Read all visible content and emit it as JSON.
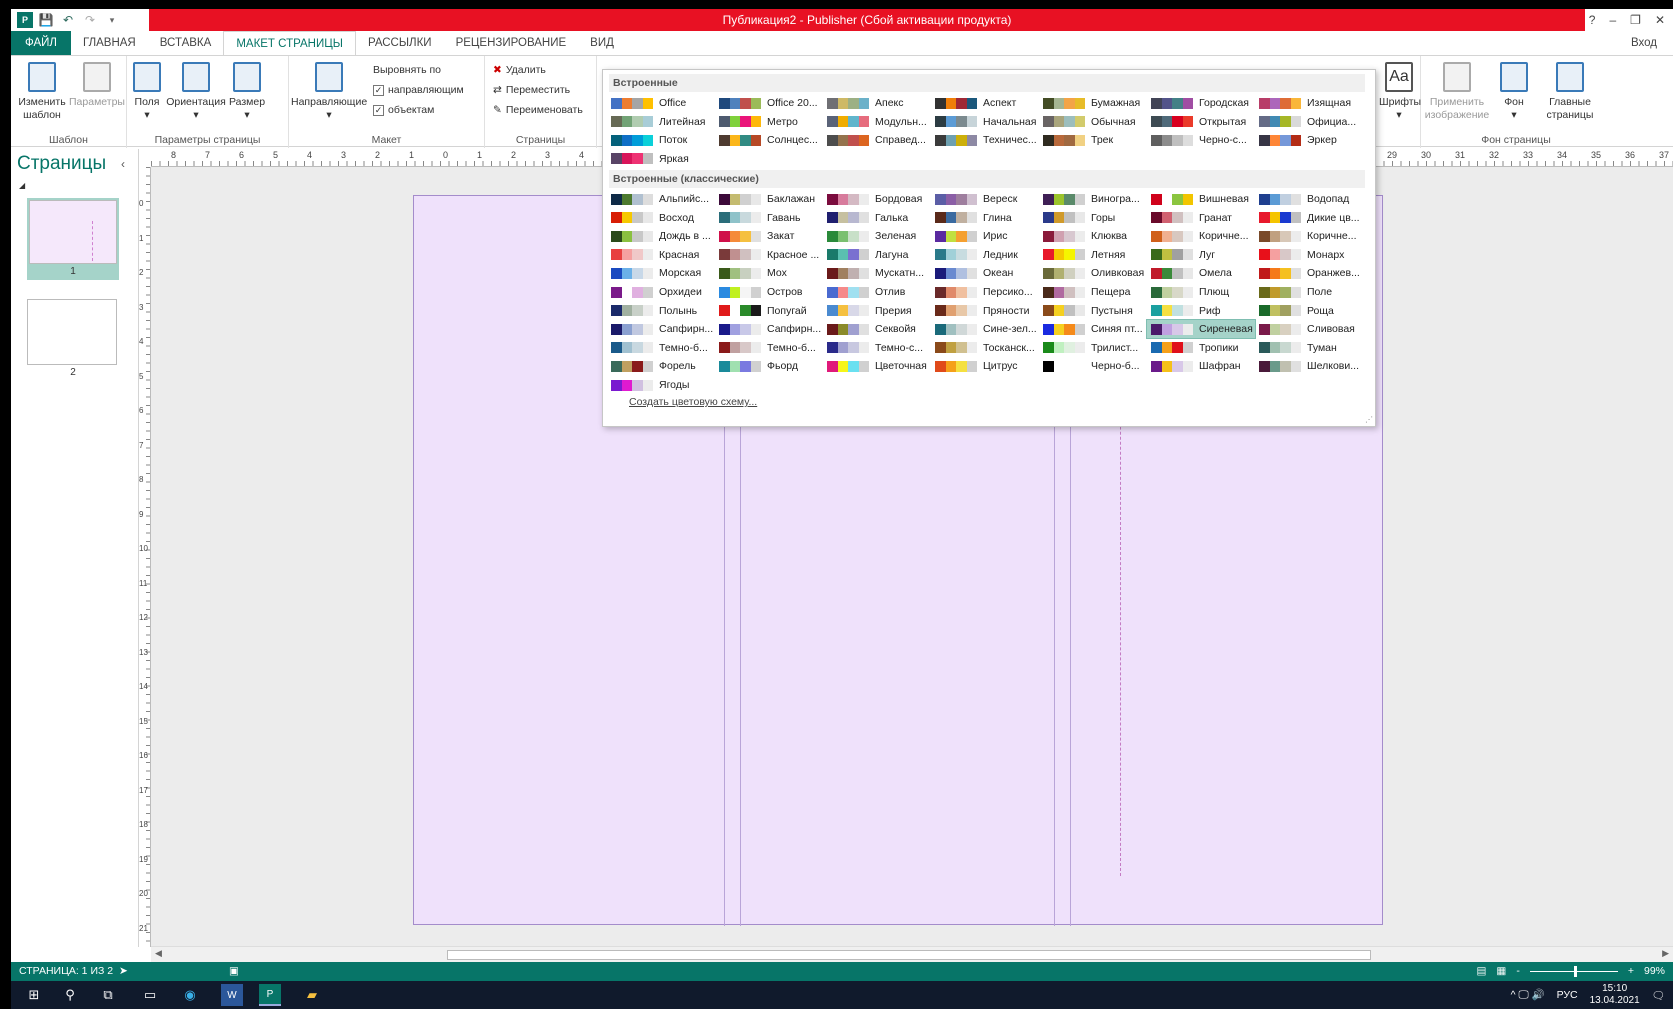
{
  "window": {
    "title": "Публикация2 -  Publisher (Сбой активации продукта)",
    "help": "?",
    "controls": [
      "–",
      "❐",
      "✕"
    ]
  },
  "tabs": [
    "ФАЙЛ",
    "ГЛАВНАЯ",
    "ВСТАВКА",
    "МАКЕТ СТРАНИЦЫ",
    "РАССЫЛКИ",
    "РЕЦЕНЗИРОВАНИЕ",
    "ВИД"
  ],
  "signin": "Вход",
  "ribbon": {
    "template": {
      "label": "Шаблон",
      "change": "Изменить шаблон",
      "params": "Параметры"
    },
    "page_setup": {
      "label": "Параметры страницы",
      "margins": "Поля",
      "orientation": "Ориентация",
      "size": "Размер"
    },
    "layout": {
      "label": "Макет",
      "guides": "Направляющие",
      "align_by": "Выровнять по",
      "to_guides": "направляющим",
      "to_objects": "объектам"
    },
    "pages": {
      "label": "Страницы",
      "delete": "Удалить",
      "move": "Переместить",
      "rename": "Переименовать"
    },
    "fonts": "Шрифты",
    "fonts_icon_text": "Aa",
    "background": {
      "label": "Фон страницы",
      "apply_image": "Применить изображение",
      "bg": "Фон",
      "master": "Главные страницы"
    }
  },
  "ruler_labels": [
    "8",
    "7",
    "6",
    "5",
    "4",
    "3",
    "2",
    "1",
    "0",
    "1",
    "2",
    "3",
    "4"
  ],
  "ruler_labels_right": [
    "29",
    "30",
    "31",
    "32",
    "33",
    "34",
    "35",
    "36",
    "37"
  ],
  "vruler_labels": [
    "0",
    "1",
    "2",
    "3",
    "4",
    "5",
    "6",
    "7",
    "8",
    "9",
    "10",
    "11",
    "12",
    "13",
    "14",
    "15",
    "16",
    "17",
    "18",
    "19",
    "20",
    "21"
  ],
  "pages_panel": {
    "title": "Страницы",
    "pages": [
      "1",
      "2"
    ]
  },
  "dropdown": {
    "builtin_title": "Встроенные",
    "classic_title": "Встроенные (классические)",
    "create_link": "Создать цветовую схему...",
    "builtin": [
      {
        "name": "Office",
        "c": [
          "#4472c4",
          "#ed7d31",
          "#a5a5a5",
          "#ffc000"
        ]
      },
      {
        "name": "Office 20...",
        "c": [
          "#1f497d",
          "#4f81bd",
          "#c0504d",
          "#9bbb59"
        ]
      },
      {
        "name": "Апекс",
        "c": [
          "#6f6f74",
          "#ceb966",
          "#9cb084",
          "#6bb1c9"
        ]
      },
      {
        "name": "Аспект",
        "c": [
          "#323232",
          "#f07f09",
          "#9f2936",
          "#1b587c"
        ]
      },
      {
        "name": "Бумажная",
        "c": [
          "#444d26",
          "#a5b592",
          "#f3a447",
          "#e7bc29"
        ]
      },
      {
        "name": "Городская",
        "c": [
          "#424456",
          "#53548a",
          "#438086",
          "#a04da3"
        ]
      },
      {
        "name": "Изящная",
        "c": [
          "#b83d68",
          "#ac66bb",
          "#de6c36",
          "#f9b639"
        ]
      },
      {
        "name": "Литейная",
        "c": [
          "#676a55",
          "#72a376",
          "#b0ccb0",
          "#a8cdd7"
        ]
      },
      {
        "name": "Метро",
        "c": [
          "#4e5b6f",
          "#7fd13b",
          "#ea157a",
          "#feb80a"
        ]
      },
      {
        "name": "Модульн...",
        "c": [
          "#5a6378",
          "#f0ad00",
          "#60b5cc",
          "#e66c7d"
        ]
      },
      {
        "name": "Начальная",
        "c": [
          "#2c3c43",
          "#5b9bd5",
          "#7b8a8f",
          "#c7d4d9"
        ]
      },
      {
        "name": "Обычная",
        "c": [
          "#696464",
          "#a9a57c",
          "#9cbebd",
          "#d2cb6c"
        ]
      },
      {
        "name": "Открытая",
        "c": [
          "#3d4b53",
          "#4f6a7a",
          "#d8001f",
          "#ea3a2a"
        ]
      },
      {
        "name": "Официа...",
        "c": [
          "#646b86",
          "#418ab3",
          "#a6b727",
          "#d9d9d9"
        ]
      },
      {
        "name": "Поток",
        "c": [
          "#04617b",
          "#0f6fc6",
          "#009dd9",
          "#0bd0d9"
        ]
      },
      {
        "name": "Солнцес...",
        "c": [
          "#4e3b30",
          "#fbb61a",
          "#318b83",
          "#b64926"
        ]
      },
      {
        "name": "Справед...",
        "c": [
          "#4d4d4d",
          "#94734d",
          "#c0504d",
          "#dc6520"
        ]
      },
      {
        "name": "Техничес...",
        "c": [
          "#3b3b3b",
          "#6ea0b0",
          "#ccaf0a",
          "#8d89a4"
        ]
      },
      {
        "name": "Трек",
        "c": [
          "#2f2b20",
          "#b8693b",
          "#a06940",
          "#f1d183"
        ]
      },
      {
        "name": "Черно-с...",
        "c": [
          "#5f5f5f",
          "#8c8c8c",
          "#bfbfbf",
          "#dddddd"
        ]
      },
      {
        "name": "Эркер",
        "c": [
          "#373545",
          "#fe8637",
          "#7598d9",
          "#b32c16"
        ]
      },
      {
        "name": "Яркая",
        "c": [
          "#594466",
          "#d8145a",
          "#ee3273",
          "#bfbfbf"
        ]
      }
    ],
    "classic": [
      {
        "name": "Альпийс...",
        "c": [
          "#0e2a47",
          "#4d7a2f",
          "#b0c0d0",
          "#dddddd"
        ]
      },
      {
        "name": "Баклажан",
        "c": [
          "#3c0a3a",
          "#c4bb70",
          "#d0d0d0",
          "#e8e8e8"
        ]
      },
      {
        "name": "Бордовая",
        "c": [
          "#7b0c3e",
          "#d77b9c",
          "#d4b9c3",
          "#ececec"
        ]
      },
      {
        "name": "Вереск",
        "c": [
          "#5b5ea6",
          "#8b5ea6",
          "#9e7e9e",
          "#d0c0d0"
        ]
      },
      {
        "name": "Виногра...",
        "c": [
          "#3f1f55",
          "#9bc42c",
          "#5a8a6a",
          "#d0d0d0"
        ]
      },
      {
        "name": "Вишневая",
        "c": [
          "#d0021b",
          "#ffffff",
          "#8bc53f",
          "#f2c500"
        ]
      },
      {
        "name": "Водопад",
        "c": [
          "#1f3f8f",
          "#5b9bd5",
          "#c0cfe0",
          "#e0e0e0"
        ]
      },
      {
        "name": "Восход",
        "c": [
          "#d81e05",
          "#f6c800",
          "#c8c8c8",
          "#e8e8e8"
        ]
      },
      {
        "name": "Гавань",
        "c": [
          "#2a6d7a",
          "#8ec2c9",
          "#c8d9dd",
          "#ececec"
        ]
      },
      {
        "name": "Галька",
        "c": [
          "#1f1f6f",
          "#c6c0a0",
          "#b8b8d0",
          "#e0e0e0"
        ]
      },
      {
        "name": "Глина",
        "c": [
          "#5a2a1a",
          "#3a6aa0",
          "#c0b0a0",
          "#e0e0e0"
        ]
      },
      {
        "name": "Горы",
        "c": [
          "#2a3a8a",
          "#d09a2a",
          "#c0c0c0",
          "#e8e8e8"
        ]
      },
      {
        "name": "Гранат",
        "c": [
          "#6a0a2a",
          "#d06070",
          "#d0c0c0",
          "#ececec"
        ]
      },
      {
        "name": "Дикие цв...",
        "c": [
          "#e8192c",
          "#f5c400",
          "#1a3ad0",
          "#c0c0c0"
        ]
      },
      {
        "name": "Дождь в ...",
        "c": [
          "#2a4a1a",
          "#8ac040",
          "#c8c8c8",
          "#e8e8e8"
        ]
      },
      {
        "name": "Закат",
        "c": [
          "#d0104a",
          "#f58a3a",
          "#f5c040",
          "#e0e0e0"
        ]
      },
      {
        "name": "Зеленая",
        "c": [
          "#2a8a3a",
          "#7ac070",
          "#c8e0c8",
          "#ececec"
        ]
      },
      {
        "name": "Ирис",
        "c": [
          "#5a2aa0",
          "#c0e040",
          "#f5a030",
          "#d0d0d0"
        ]
      },
      {
        "name": "Клюква",
        "c": [
          "#8a1a3a",
          "#d0a0b0",
          "#d8c8d0",
          "#ececec"
        ]
      },
      {
        "name": "Коричне...",
        "c": [
          "#d0601a",
          "#f0b090",
          "#d8c8c0",
          "#ececec"
        ]
      },
      {
        "name": "Коричне...",
        "c": [
          "#7a4a2a",
          "#c0a080",
          "#d8c8b8",
          "#ececec"
        ]
      },
      {
        "name": "Красная",
        "c": [
          "#e84040",
          "#f5a0a0",
          "#f0c8c8",
          "#ececec"
        ]
      },
      {
        "name": "Красное ...",
        "c": [
          "#7a3a3a",
          "#c09090",
          "#d0c0c0",
          "#ececec"
        ]
      },
      {
        "name": "Лагуна",
        "c": [
          "#1a7a6a",
          "#5ac0b0",
          "#7a70d0",
          "#d0d0d0"
        ]
      },
      {
        "name": "Ледник",
        "c": [
          "#2a7a8a",
          "#a0d0d8",
          "#c8dce0",
          "#ececec"
        ]
      },
      {
        "name": "Летняя",
        "c": [
          "#e81a2a",
          "#f5c800",
          "#f5f500",
          "#d0d0d0"
        ]
      },
      {
        "name": "Луг",
        "c": [
          "#3a6a1a",
          "#c0c040",
          "#a0a0a0",
          "#e0e0e0"
        ]
      },
      {
        "name": "Монарх",
        "c": [
          "#e8101a",
          "#f5a0a0",
          "#d8c8c8",
          "#ececec"
        ]
      },
      {
        "name": "Морская",
        "c": [
          "#1a4ac0",
          "#6ab0e8",
          "#c8d8e8",
          "#ececec"
        ]
      },
      {
        "name": "Мох",
        "c": [
          "#3a5a1a",
          "#a0c080",
          "#c8d0c0",
          "#ececec"
        ]
      },
      {
        "name": "Мускатн...",
        "c": [
          "#6a1a1a",
          "#a08060",
          "#c0b0b0",
          "#e0e0e0"
        ]
      },
      {
        "name": "Океан",
        "c": [
          "#1a1a7a",
          "#6a8ad0",
          "#b0c0e0",
          "#e0e0e0"
        ]
      },
      {
        "name": "Оливковая",
        "c": [
          "#6a6a3a",
          "#b0b070",
          "#d0d0c0",
          "#ececec"
        ]
      },
      {
        "name": "Омела",
        "c": [
          "#c01a2a",
          "#3a8a3a",
          "#c0c0c0",
          "#e8e8e8"
        ]
      },
      {
        "name": "Оранжев...",
        "c": [
          "#c01a1a",
          "#f57a1a",
          "#f5c020",
          "#e0e0e0"
        ]
      },
      {
        "name": "Орхидеи",
        "c": [
          "#7a1a8a",
          "#ffffff",
          "#e0b0e0",
          "#d0d0d0"
        ]
      },
      {
        "name": "Остров",
        "c": [
          "#2a8ae0",
          "#c0f020",
          "#f5f5f5",
          "#d0d0d0"
        ]
      },
      {
        "name": "Отлив",
        "c": [
          "#4a6ad0",
          "#f58a8a",
          "#a0e0f0",
          "#d0d0d0"
        ]
      },
      {
        "name": "Персико...",
        "c": [
          "#6a2a2a",
          "#e08a6a",
          "#f0c0a0",
          "#ececec"
        ]
      },
      {
        "name": "Пещера",
        "c": [
          "#4a2a1a",
          "#b06aa0",
          "#d0c0c0",
          "#ececec"
        ]
      },
      {
        "name": "Плющ",
        "c": [
          "#2a6a3a",
          "#c0d0a0",
          "#d8d8c8",
          "#ececec"
        ]
      },
      {
        "name": "Поле",
        "c": [
          "#6a6a1a",
          "#c09a2a",
          "#a0b060",
          "#e0e0e0"
        ]
      },
      {
        "name": "Полынь",
        "c": [
          "#1a2a6a",
          "#a0b0a0",
          "#c8d0c8",
          "#ececec"
        ]
      },
      {
        "name": "Попугай",
        "c": [
          "#e01a1a",
          "#ffffff",
          "#2a8a2a",
          "#1a1a1a"
        ]
      },
      {
        "name": "Прерия",
        "c": [
          "#4a8ad0",
          "#f5c040",
          "#d8d8e8",
          "#ececec"
        ]
      },
      {
        "name": "Пряности",
        "c": [
          "#6a2a1a",
          "#e0a070",
          "#e8c8a8",
          "#ececec"
        ]
      },
      {
        "name": "Пустыня",
        "c": [
          "#8a4a1a",
          "#f5d020",
          "#c0c0c0",
          "#e8e8e8"
        ]
      },
      {
        "name": "Риф",
        "c": [
          "#1aa0a0",
          "#f5e040",
          "#c0e0e0",
          "#ececec"
        ]
      },
      {
        "name": "Роща",
        "c": [
          "#1a6a2a",
          "#c0c060",
          "#a0a060",
          "#e0e0e0"
        ]
      },
      {
        "name": "Сапфирн...",
        "c": [
          "#1a1a6a",
          "#8aa0d0",
          "#c0c8e0",
          "#ececec"
        ]
      },
      {
        "name": "Сапфирн...",
        "c": [
          "#1a1a8a",
          "#a0a0e0",
          "#c8c8e8",
          "#ececec"
        ]
      },
      {
        "name": "Секвойя",
        "c": [
          "#6a1a1a",
          "#8a8a2a",
          "#a0a0d0",
          "#e0e0e0"
        ]
      },
      {
        "name": "Сине-зел...",
        "c": [
          "#1a6a7a",
          "#a0c0c0",
          "#d0d8d8",
          "#ececec"
        ]
      },
      {
        "name": "Синяя пт...",
        "c": [
          "#1a2ae0",
          "#f5d020",
          "#f58a1a",
          "#d0d0d0"
        ]
      },
      {
        "name": "Сиреневая",
        "c": [
          "#4a1a6a",
          "#c0a0e0",
          "#d8c8e8",
          "#ececec"
        ]
      },
      {
        "name": "Сливовая",
        "c": [
          "#7a1a4a",
          "#c0d0a0",
          "#d8d0c0",
          "#ececec"
        ]
      },
      {
        "name": "Темно-б...",
        "c": [
          "#1a5a8a",
          "#a0c0d0",
          "#c8d8e0",
          "#ececec"
        ]
      },
      {
        "name": "Темно-б...",
        "c": [
          "#8a1a1a",
          "#c0a0a0",
          "#d8c8c8",
          "#ececec"
        ]
      },
      {
        "name": "Темно-с...",
        "c": [
          "#2a2a8a",
          "#a0a0d0",
          "#c8c8e0",
          "#ececec"
        ]
      },
      {
        "name": "Тосканск...",
        "c": [
          "#8a4a1a",
          "#c0a040",
          "#d0c090",
          "#ececec"
        ]
      },
      {
        "name": "Трилист...",
        "c": [
          "#1a8a1a",
          "#c0f0c0",
          "#e0f0e0",
          "#ececec"
        ]
      },
      {
        "name": "Тропики",
        "c": [
          "#1a6ab0",
          "#f5a01a",
          "#e0101a",
          "#d0d0d0"
        ]
      },
      {
        "name": "Туман",
        "c": [
          "#2a5a5a",
          "#a0c0b0",
          "#c8d8d0",
          "#ececec"
        ]
      },
      {
        "name": "Форель",
        "c": [
          "#3a6a5a",
          "#c0a060",
          "#8a1a1a",
          "#d0d0d0"
        ]
      },
      {
        "name": "Фьорд",
        "c": [
          "#1a8a9a",
          "#a0e0b0",
          "#7a7ae0",
          "#d0d0d0"
        ]
      },
      {
        "name": "Цветочная",
        "c": [
          "#e01a7a",
          "#f5f51a",
          "#6ae0f0",
          "#d0d0d0"
        ]
      },
      {
        "name": "Цитрус",
        "c": [
          "#e04a1a",
          "#f5a01a",
          "#f5e040",
          "#d0d0d0"
        ]
      },
      {
        "name": "Черно-б...",
        "c": [
          "#000000",
          "#ffffff",
          "#ffffff",
          "#ffffff"
        ]
      },
      {
        "name": "Шафран",
        "c": [
          "#6a1a8a",
          "#f5c01a",
          "#d8c8e8",
          "#ececec"
        ]
      },
      {
        "name": "Шелкови...",
        "c": [
          "#4a1a3a",
          "#6a9a8a",
          "#c0c0b0",
          "#e0e0e0"
        ]
      },
      {
        "name": "Ягоды",
        "c": [
          "#7a1ad0",
          "#e01ad0",
          "#d0c0e0",
          "#ececec"
        ]
      }
    ],
    "selected": "Сиреневая"
  },
  "status": {
    "page": "СТРАНИЦА: 1 ИЗ 2",
    "zoom": "99%",
    "zoom_minus": "-",
    "zoom_plus": "+"
  },
  "taskbar": {
    "lang": "РУС",
    "time": "15:10",
    "date": "13.04.2021",
    "tray": "^  🖵 🔊"
  }
}
